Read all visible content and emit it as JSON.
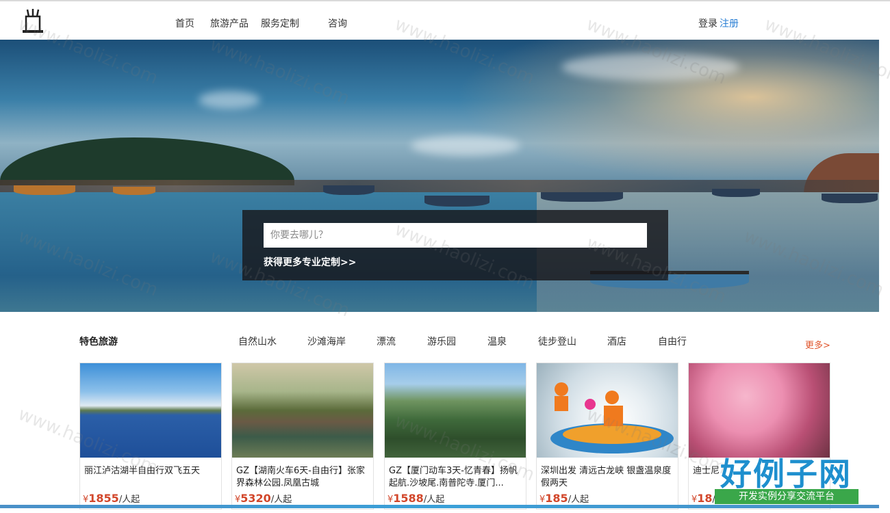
{
  "header": {
    "nav": [
      "首页",
      "旅游产品",
      "服务定制",
      "咨询"
    ],
    "login": "登录",
    "register": "注册"
  },
  "hero": {
    "search_placeholder": "你要去哪儿？",
    "more_custom": "获得更多专业定制>>"
  },
  "featured": {
    "title": "特色旅游",
    "tabs": [
      "自然山水",
      "沙滩海岸",
      "漂流",
      "游乐园",
      "温泉",
      "徒步登山",
      "酒店",
      "自由行"
    ],
    "more": "更多>",
    "price_unit": "/人起",
    "currency": "¥",
    "cards": [
      {
        "name": "丽江泸沽湖半自由行双飞五天",
        "price": "1855"
      },
      {
        "name": "GZ【湖南火车6天-自由行】张家界森林公园.凤凰古城",
        "price": "5320"
      },
      {
        "name": "GZ【厦门动车3天-忆青春】扬帆起航.沙坡尾.南普陀寺.厦门...",
        "price": "1588"
      },
      {
        "name": "深圳出发 清远古龙峡 银盏温泉度假两天",
        "price": "185"
      },
      {
        "name": "迪士尼",
        "price": "18"
      }
    ]
  },
  "brand": {
    "title": "好例子网",
    "subtitle": "开发实例分享交流平台"
  },
  "watermark": "www.haolizi.com",
  "colors": {
    "accent_blue": "#2a7fd4",
    "price_red": "#d2462a",
    "more_orange": "#e0552c",
    "brand_green": "#3aa74a"
  }
}
